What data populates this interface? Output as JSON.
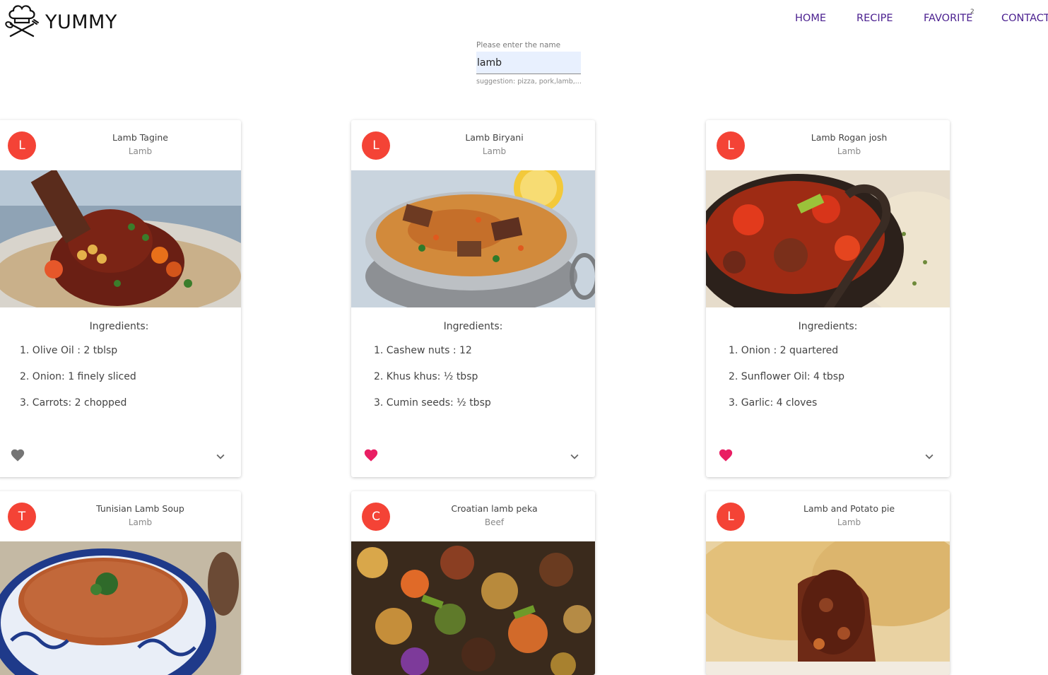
{
  "brand": {
    "name": "YUMMY",
    "logo_icon": "chef-hat-crossed-utensils-icon"
  },
  "nav": {
    "items": [
      {
        "label": "HOME"
      },
      {
        "label": "RECIPE"
      },
      {
        "label": "FAVORITE",
        "badge": "2"
      },
      {
        "label": "CONTACT"
      }
    ]
  },
  "search": {
    "label": "Please enter the name",
    "value": "lamb",
    "hint": "suggestion: pizza, pork,lamb,..."
  },
  "colors": {
    "accent_nav": "#4a1f8f",
    "avatar": "#f44336",
    "heart_active": "#e91e63",
    "heart_inactive": "#757575"
  },
  "ingredients_heading": "Ingredients:",
  "cards": [
    {
      "initial": "L",
      "title": "Lamb Tagine",
      "category": "Lamb",
      "favorite": false,
      "ingredients": [
        "1. Olive Oil : 2 tblsp",
        "2. Onion: 1 finely sliced",
        "3. Carrots: 2 chopped"
      ]
    },
    {
      "initial": "L",
      "title": "Lamb Biryani",
      "category": "Lamb",
      "favorite": true,
      "ingredients": [
        "1. Cashew nuts : 12",
        "2. Khus khus: ½ tbsp",
        "3. Cumin seeds: ½ tbsp"
      ]
    },
    {
      "initial": "L",
      "title": "Lamb Rogan josh",
      "category": "Lamb",
      "favorite": true,
      "ingredients": [
        "1. Onion : 2 quartered",
        "2. Sunflower Oil: 4 tbsp",
        "3. Garlic: 4 cloves"
      ]
    },
    {
      "initial": "T",
      "title": "Tunisian Lamb Soup",
      "category": "Lamb"
    },
    {
      "initial": "C",
      "title": "Croatian lamb peka",
      "category": "Beef"
    },
    {
      "initial": "L",
      "title": "Lamb and Potato pie",
      "category": "Lamb"
    }
  ]
}
